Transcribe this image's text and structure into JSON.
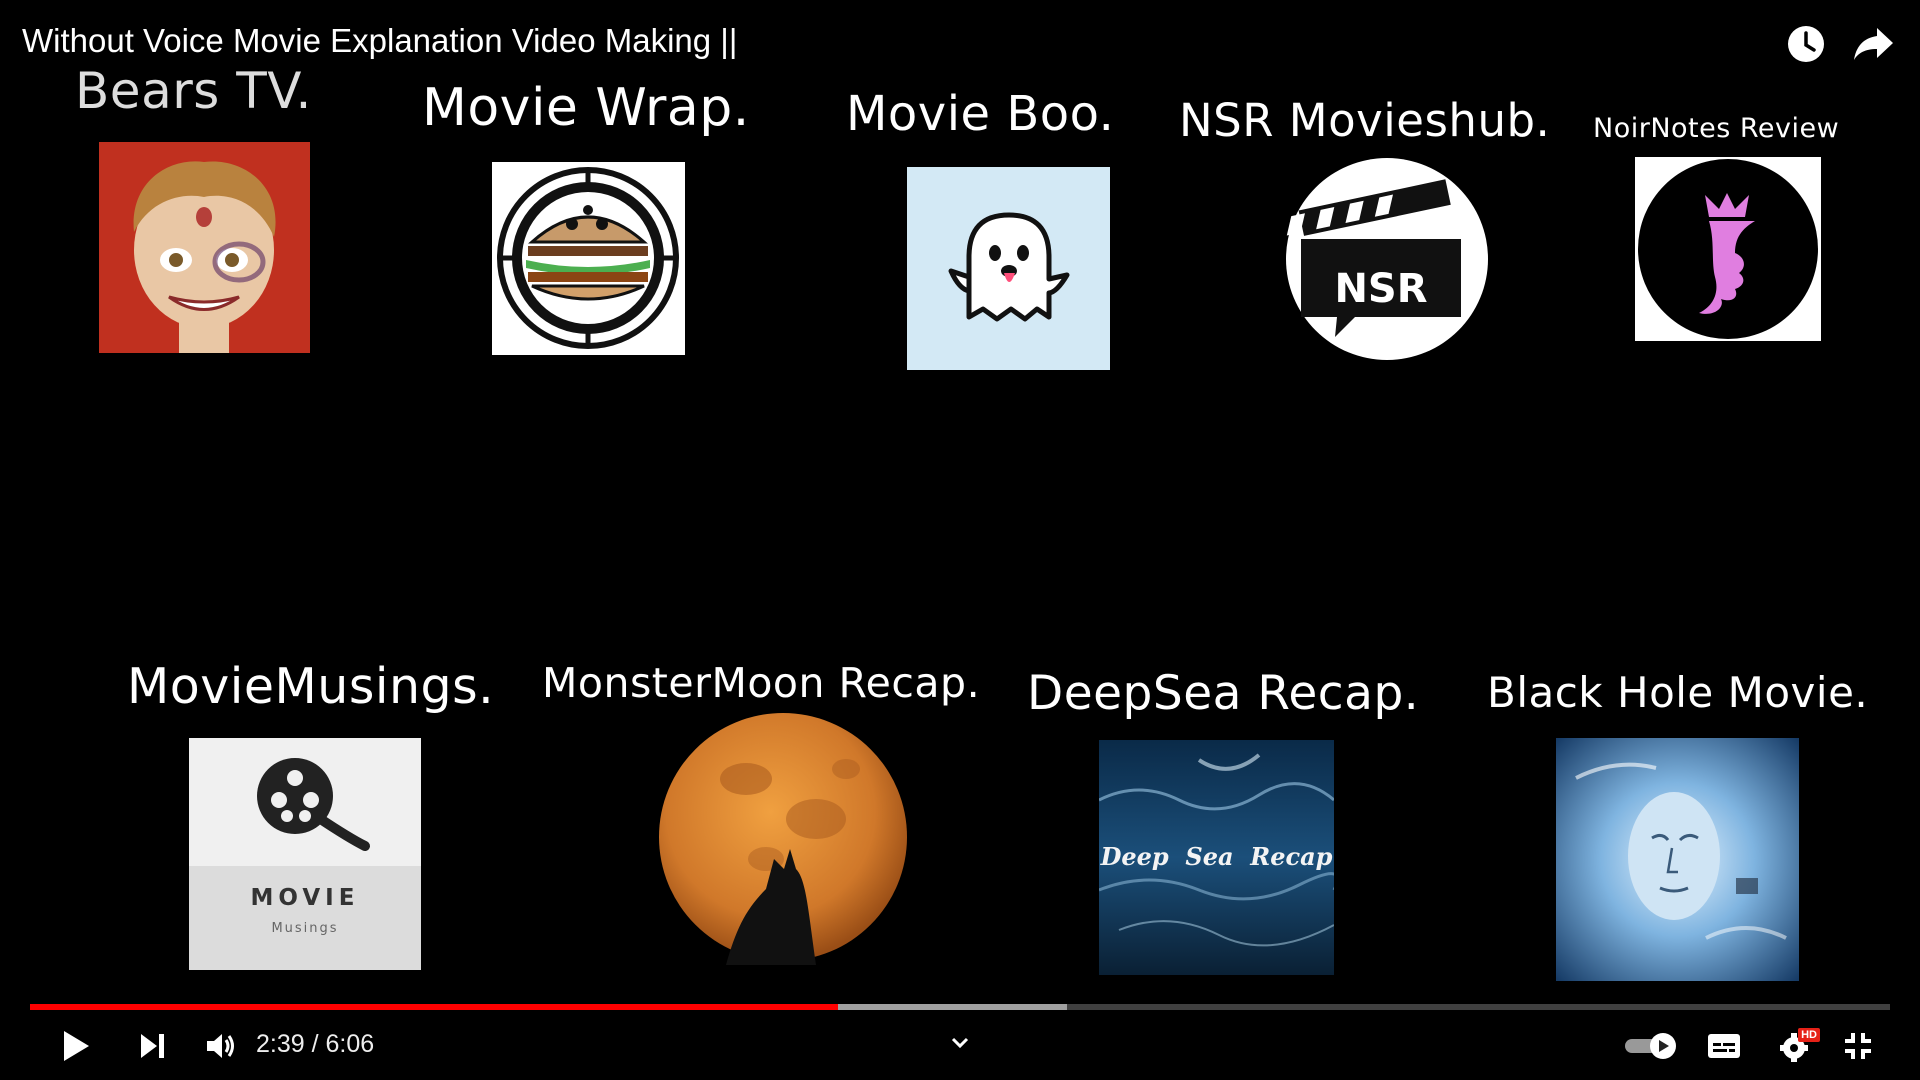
{
  "video": {
    "title": "Without Voice Movie Explanation Video Making ||",
    "current_time": "2:39",
    "separator": " / ",
    "duration": "6:06",
    "progress_played_fraction": 0.4344,
    "progress_buffered_fraction": 0.5575,
    "hd_badge": "HD"
  },
  "channels": [
    {
      "label": "Bears TV."
    },
    {
      "label": "Movie Wrap."
    },
    {
      "label": "Movie Boo."
    },
    {
      "label": "NSR Movieshub."
    },
    {
      "label": "NoirNotes Review"
    },
    {
      "label": "MovieMusings."
    },
    {
      "label": "MonsterMoon Recap."
    },
    {
      "label": "DeepSea Recap."
    },
    {
      "label": "Black Hole Movie."
    }
  ],
  "logos": {
    "nsr_text": "NSR",
    "movie_musings_text": "MOVIE",
    "movie_musings_sub": "Musings",
    "deep_sea_text": "Deep  Sea  Recap"
  },
  "colors": {
    "progress_red": "#ff0000",
    "background": "#000000"
  }
}
